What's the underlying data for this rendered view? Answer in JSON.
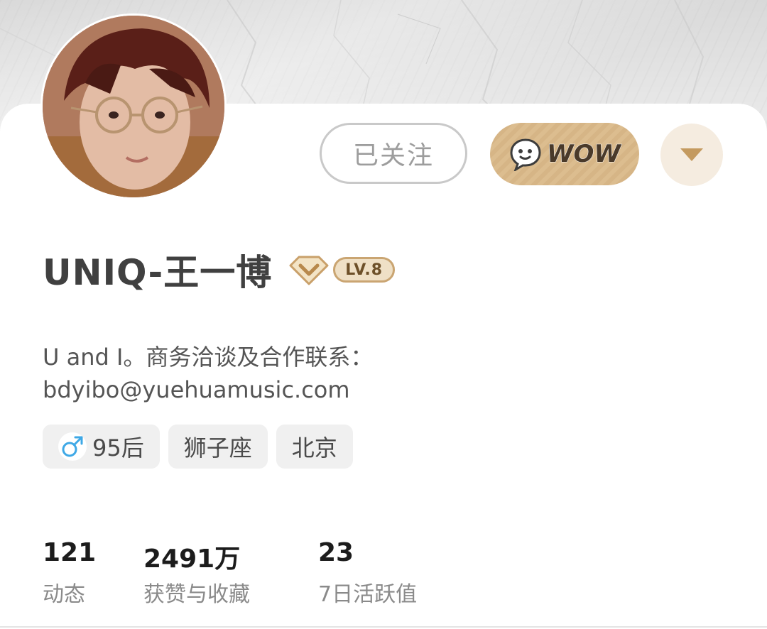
{
  "profile": {
    "name": "UNIQ-王一博",
    "level": "LV.8",
    "avatar": "avatar",
    "bio_line1": "U and I。商务洽谈及合作联系：",
    "bio_line2": "bdyibo@yuehuamusic.com"
  },
  "actions": {
    "follow_label": "已关注",
    "wow_label": "WOW",
    "more_icon": "caret-down-icon"
  },
  "tags": {
    "gender_icon": "male-icon",
    "age": "95后",
    "zodiac": "狮子座",
    "location": "北京"
  },
  "stats": [
    {
      "value": "121",
      "label": "动态"
    },
    {
      "value": "2491万",
      "label": "获赞与收藏"
    },
    {
      "value": "23",
      "label": "7日活跃值"
    }
  ],
  "colors": {
    "wow_gold": "#dcbd8f",
    "level_gold": "#caa572",
    "gender_blue": "#3ea8e6",
    "text_dark": "#404040",
    "text_muted": "#8a8a8a"
  }
}
